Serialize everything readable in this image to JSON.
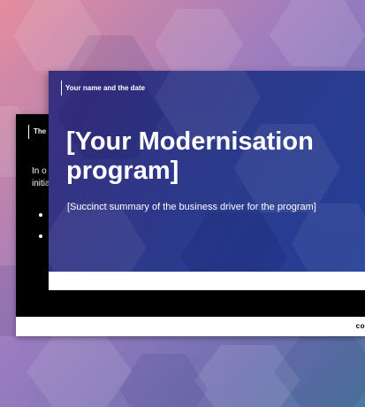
{
  "background": {
    "gradient_start": "#e58d9c",
    "gradient_mid": "#8b77bf",
    "gradient_end": "#4a7aa0"
  },
  "back_slide": {
    "header": "The l",
    "body_text": "In o initia two",
    "footer_logo": "co"
  },
  "front_slide": {
    "meta": "Your name and the date",
    "title": "[Your Modernisation program]",
    "summary": "[Succinct summary of the business driver for the program]",
    "bg_color": "#2f3a8c"
  }
}
